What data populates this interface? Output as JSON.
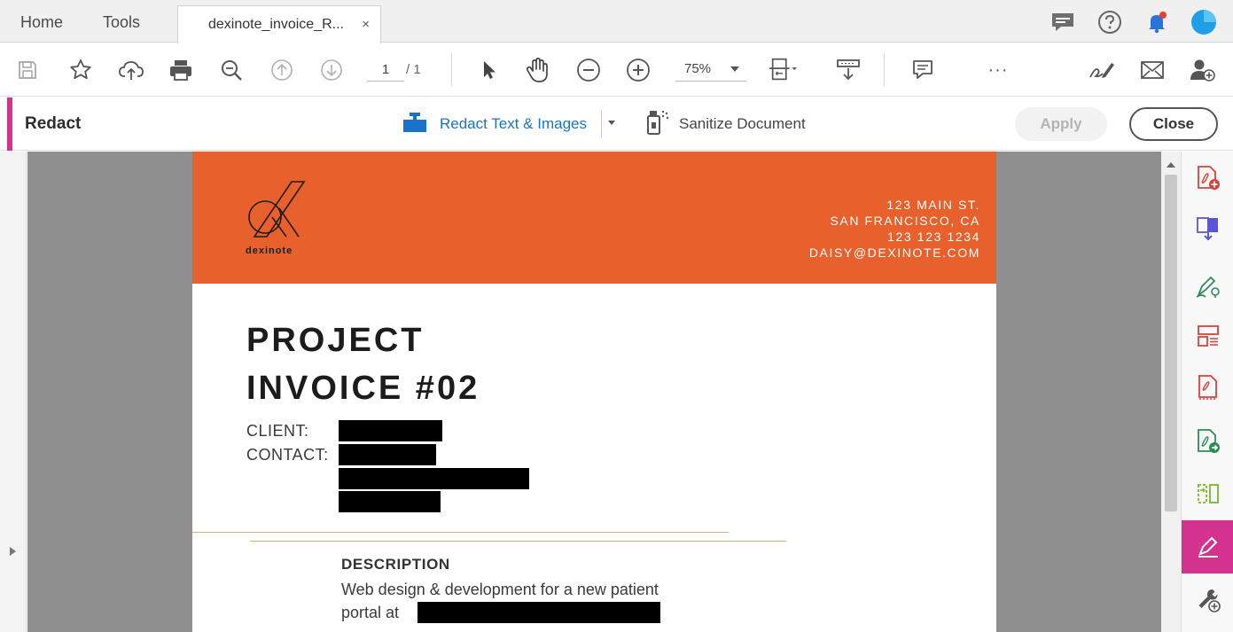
{
  "tabbar": {
    "home_label": "Home",
    "tools_label": "Tools",
    "document_tab_label": "dexinote_invoice_R...",
    "close_tab_glyph": "×"
  },
  "toolbar": {
    "current_page": "1",
    "total_pages": "/ 1",
    "zoom_value": "75%",
    "more_glyph": "···"
  },
  "redact_bar": {
    "title": "Redact",
    "redact_tool_label": "Redact Text & Images",
    "sanitize_label": "Sanitize Document",
    "apply_label": "Apply",
    "close_label": "Close"
  },
  "document": {
    "brand_name": "dexinote",
    "address_line1": "123 MAIN ST.",
    "address_line2": "SAN FRANCISCO, CA",
    "phone": "123 123 1234",
    "email": "DAISY@DEXINOTE.COM",
    "title_line1": "PROJECT",
    "title_line2": "INVOICE #02",
    "client_label": "CLIENT:",
    "contact_label": "CONTACT:",
    "description_label": "DESCRIPTION",
    "description_line1": "Web design & development for a new patient",
    "description_line2": "portal at"
  },
  "colors": {
    "header_orange": "#e8602b",
    "accent_magenta": "#d3338f",
    "link_blue": "#1a73c9",
    "redaction_black": "#000000",
    "viewer_gray": "#8f8f8f"
  },
  "icons": {
    "toolbar": [
      "save-icon",
      "bookmark-star-icon",
      "upload-cloud-icon",
      "print-icon",
      "zoom-search-icon",
      "page-up-icon",
      "page-down-icon",
      "select-arrow-icon",
      "hand-pan-icon",
      "zoom-out-icon",
      "zoom-in-icon",
      "fit-page-icon",
      "scroll-mode-icon",
      "comment-icon",
      "more-icon",
      "sign-icon",
      "email-icon",
      "add-user-icon"
    ],
    "right_rail": [
      "create-pdf-icon",
      "combine-files-icon",
      "fill-sign-icon",
      "organize-pages-icon",
      "export-pdf-icon",
      "edit-pdf-icon",
      "compare-icon",
      "redact-icon",
      "more-tools-icon"
    ]
  }
}
